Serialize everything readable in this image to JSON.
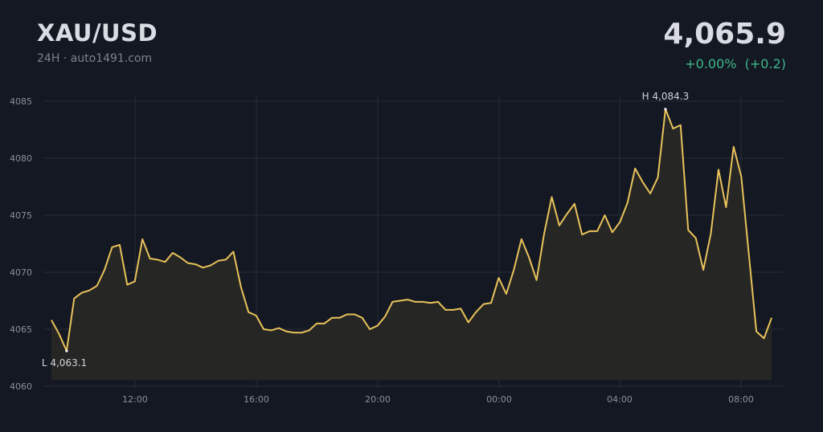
{
  "header": {
    "symbol": "XAU/USD",
    "subtitle": "24H · auto1491.com",
    "price": "4,065.9",
    "change_pct": "+0.00%",
    "change_abs": "(+0.2)",
    "change_color": "#3fb68b"
  },
  "colors": {
    "line": "#e8c25a",
    "area": "#262625",
    "grid": "#262b36",
    "background": "#141822"
  },
  "chart_data": {
    "type": "area",
    "title": "XAU/USD",
    "xlabel": "",
    "ylabel": "",
    "ylim": [
      4060,
      4085
    ],
    "y_ticks": [
      "4060",
      "4065",
      "4070",
      "4075",
      "4080",
      "4085"
    ],
    "x_ticks": [
      "12:00",
      "16:00",
      "20:00",
      "00:00",
      "04:00",
      "08:00"
    ],
    "grid": true,
    "high_label": "H 4,084.3",
    "low_label": "L 4,063.1",
    "series": [
      {
        "values": [
          4065.8,
          4064.6,
          4063.1,
          4067.7,
          4068.2,
          4068.4,
          4068.8,
          4070.2,
          4072.2,
          4072.4,
          4068.9,
          4069.2,
          4072.9,
          4071.2,
          4071.1,
          4070.9,
          4071.7,
          4071.3,
          4070.8,
          4070.7,
          4070.4,
          4070.6,
          4071.0,
          4071.1,
          4071.8,
          4068.7,
          4066.5,
          4066.2,
          4065.0,
          4064.9,
          4065.1,
          4064.8,
          4064.7,
          4064.7,
          4064.9,
          4065.5,
          4065.5,
          4066.0,
          4066.0,
          4066.3,
          4066.3,
          4066.0,
          4065.0,
          4065.3,
          4066.1,
          4067.4,
          4067.5,
          4067.6,
          4067.4,
          4067.4,
          4067.3,
          4067.4,
          4066.7,
          4066.7,
          4066.8,
          4065.6,
          4066.5,
          4067.2,
          4067.3,
          4069.5,
          4068.1,
          4070.2,
          4072.9,
          4071.3,
          4069.3,
          4073.4,
          4076.6,
          4074.1,
          4075.1,
          4076.0,
          4073.3,
          4073.6,
          4073.6,
          4075.0,
          4073.5,
          4074.4,
          4076.1,
          4079.1,
          4077.9,
          4076.9,
          4078.3,
          4084.3,
          4082.6,
          4082.9,
          4073.7,
          4073.0,
          4070.2,
          4073.4,
          4079.0,
          4075.7,
          4081.0,
          4078.4,
          4071.6,
          4064.8,
          4064.2,
          4066.0
        ]
      }
    ]
  }
}
